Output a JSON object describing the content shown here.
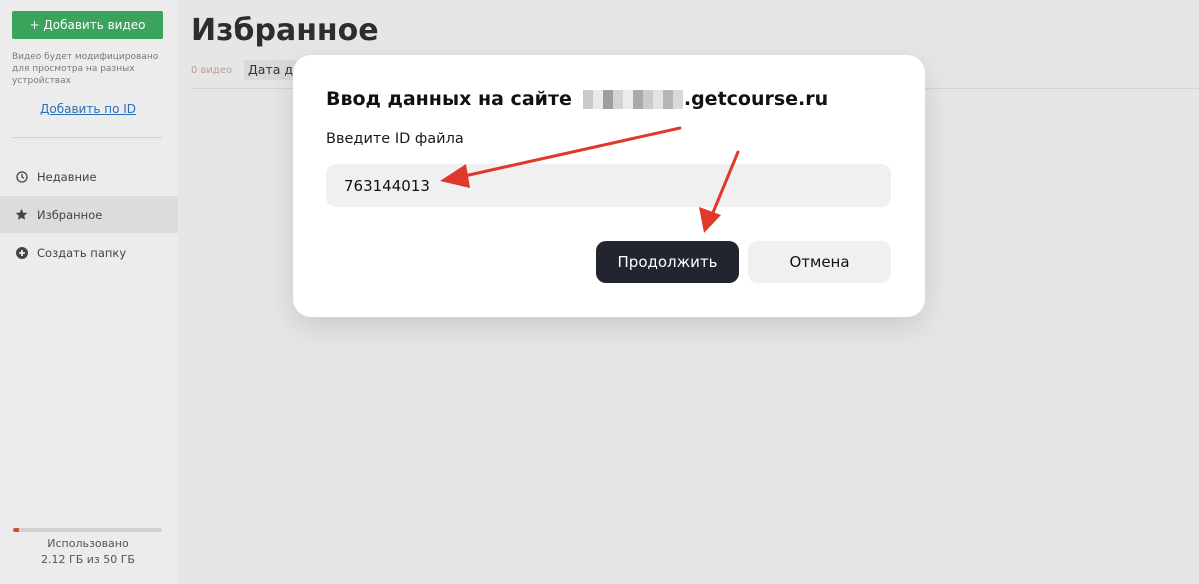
{
  "sidebar": {
    "add_video_label": "+ Добавить видео",
    "upload_note": "Видео будет модифицировано для просмотра на разных устройствах",
    "add_by_id_label": "Добавить по ID",
    "nav": {
      "recent": {
        "label": "Недавние",
        "icon": "clock-icon"
      },
      "favorites": {
        "label": "Избранное",
        "icon": "star-icon"
      },
      "create_folder": {
        "label": "Создать папку",
        "icon": "plus-circle-icon"
      }
    },
    "storage": {
      "label": "Использовано",
      "value": "2.12 ГБ из 50 ГБ",
      "used_fraction": 0.0424
    }
  },
  "main": {
    "title": "Избранное",
    "video_count": "0 видео",
    "sort_label": "Дата до"
  },
  "dialog": {
    "title_prefix": "Ввод данных на сайте",
    "title_suffix": ".getcourse.ru",
    "field_label": "Введите ID файла",
    "id_value": "763144013",
    "continue_label": "Продолжить",
    "cancel_label": "Отмена"
  },
  "colors": {
    "accent_green": "#3aa35c",
    "dark_button": "#22252d",
    "annotation_red": "#e0392b",
    "storage_fill": "#d94a3e"
  }
}
